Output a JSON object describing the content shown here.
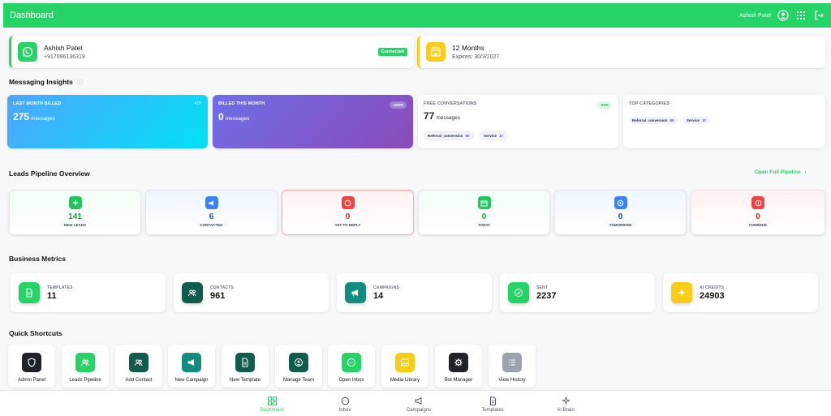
{
  "header": {
    "title": "Dashboard",
    "user_name": "Ashish Patel"
  },
  "profile": {
    "name": "Ashish Patel",
    "phone": "+917096136319",
    "status": "Connected"
  },
  "plan": {
    "title": "12 Months",
    "expires": "Expires: 30/3/2027"
  },
  "insights": {
    "title": "Messaging Insights",
    "last_month": {
      "label": "LAST MONTH BILLED",
      "value": "275",
      "unit": "messages"
    },
    "this_month": {
      "label": "BILLED THIS MONTH",
      "value": "0",
      "unit": "messages",
      "tag": "-100%"
    },
    "free": {
      "label": "FREE CONVERSATIONS",
      "value": "77",
      "unit": "messages",
      "tag": "-57%",
      "pills": [
        {
          "name": "Referral_conversion",
          "count": "60"
        },
        {
          "name": "Service",
          "count": "17"
        }
      ]
    },
    "top": {
      "label": "TOP CATEGORIES",
      "pills": [
        {
          "name": "Referral_conversion",
          "count": "60"
        },
        {
          "name": "Service",
          "count": "17"
        }
      ]
    }
  },
  "pipeline": {
    "title": "Leads Pipeline Overview",
    "link": "Open Full Pipeline",
    "items": [
      {
        "value": "141",
        "label": "NEW LEADS"
      },
      {
        "value": "6",
        "label": "CONTACTED"
      },
      {
        "value": "0",
        "label": "YET TO REPLY"
      },
      {
        "value": "0",
        "label": "TODAY"
      },
      {
        "value": "0",
        "label": "TOMORROW"
      },
      {
        "value": "0",
        "label": "OVERDUE"
      }
    ]
  },
  "metrics": {
    "title": "Business Metrics",
    "items": [
      {
        "label": "TEMPLATES",
        "value": "11"
      },
      {
        "label": "CONTACTS",
        "value": "961"
      },
      {
        "label": "CAMPAIGNS",
        "value": "14"
      },
      {
        "label": "SENT",
        "value": "2237"
      },
      {
        "label": "AI CREDITS",
        "value": "24903"
      }
    ]
  },
  "shortcuts": {
    "title": "Quick Shortcuts",
    "items": [
      {
        "label": "Admin Panel"
      },
      {
        "label": "Leads Pipeline"
      },
      {
        "label": "Add Contact"
      },
      {
        "label": "New Campaign"
      },
      {
        "label": "New Template"
      },
      {
        "label": "Manage Team"
      },
      {
        "label": "Open Inbox"
      },
      {
        "label": "Media Library"
      },
      {
        "label": "Bot Manager"
      },
      {
        "label": "View History"
      }
    ]
  },
  "nav": {
    "items": [
      {
        "label": "Dashboard"
      },
      {
        "label": "Inbox"
      },
      {
        "label": "Campaigns"
      },
      {
        "label": "Templates"
      },
      {
        "label": "AI Brain"
      }
    ]
  },
  "colors": {
    "brand": "#25d366",
    "plan_accent": "#facc15"
  }
}
